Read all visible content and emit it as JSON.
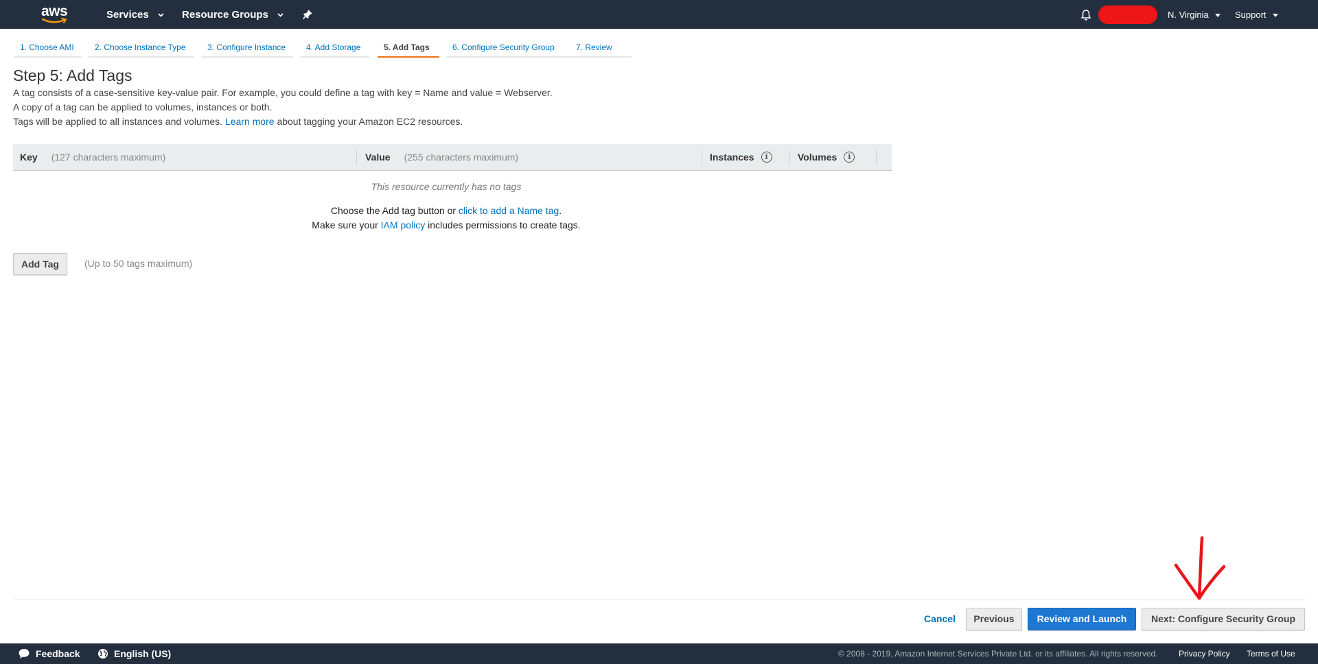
{
  "nav": {
    "logo_text": "aws",
    "services": "Services",
    "resource_groups": "Resource Groups",
    "region": "N. Virginia",
    "support": "Support"
  },
  "steps": [
    {
      "label": "1. Choose AMI",
      "active": false
    },
    {
      "label": "2. Choose Instance Type",
      "active": false
    },
    {
      "label": "3. Configure Instance",
      "active": false
    },
    {
      "label": "4. Add Storage",
      "active": false
    },
    {
      "label": "5. Add Tags",
      "active": true
    },
    {
      "label": "6. Configure Security Group",
      "active": false
    },
    {
      "label": "7. Review",
      "active": false
    }
  ],
  "page": {
    "title": "Step 5: Add Tags",
    "desc1": "A tag consists of a case-sensitive key-value pair. For example, you could define a tag with key = Name and value = Webserver.",
    "desc2": "A copy of a tag can be applied to volumes, instances or both.",
    "desc3_pre": "Tags will be applied to all instances and volumes.",
    "desc3_link": "Learn more",
    "desc3_post": "about tagging your Amazon EC2 resources."
  },
  "table": {
    "headers": {
      "key": "Key",
      "key_hint": "(127 characters maximum)",
      "value": "Value",
      "value_hint": "(255 characters maximum)",
      "instances": "Instances",
      "volumes": "Volumes"
    },
    "empty": "This resource currently has no tags",
    "hint1_pre": "Choose the Add tag button or",
    "hint1_link": "click to add a Name tag",
    "hint1_post": ".",
    "hint2_pre": "Make sure your",
    "hint2_link": "IAM policy",
    "hint2_post": "includes permissions to create tags."
  },
  "add_tag": {
    "button": "Add Tag",
    "note": "(Up to 50 tags maximum)"
  },
  "actions": {
    "cancel": "Cancel",
    "previous": "Previous",
    "review": "Review and Launch",
    "next": "Next: Configure Security Group"
  },
  "footer": {
    "feedback": "Feedback",
    "language": "English (US)",
    "copyright": "© 2008 - 2019, Amazon Internet Services Private Ltd. or its affiliates. All rights reserved.",
    "privacy": "Privacy Policy",
    "terms": "Terms of Use"
  },
  "colors": {
    "nav_bg": "#232f3e",
    "link": "#0073bb",
    "active_step": "#ec7211",
    "primary_button": "#1e78d2",
    "annotation": "#e8161b"
  }
}
